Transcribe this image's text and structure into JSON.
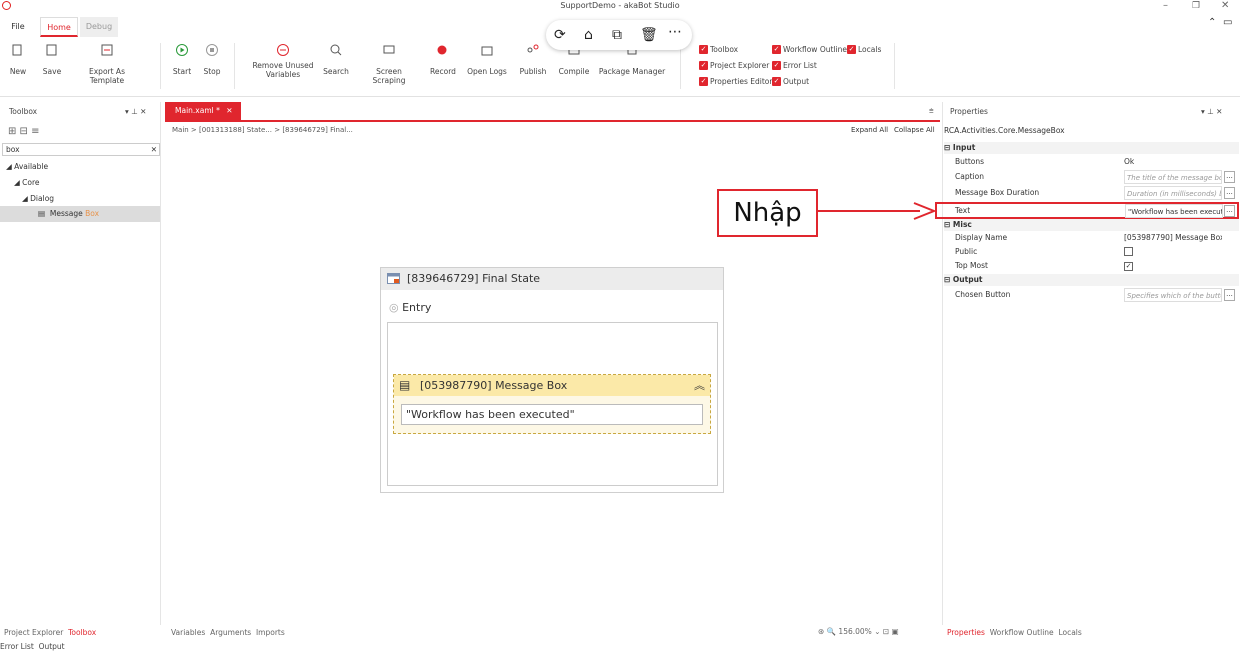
{
  "window": {
    "title": "SupportDemo - akaBot Studio"
  },
  "menu_tabs": [
    {
      "label": "File"
    },
    {
      "label": "Home"
    },
    {
      "label": "Debug"
    }
  ],
  "ribbon": {
    "new": "New",
    "save": "Save",
    "export": "Export As Template",
    "start": "Start",
    "stop": "Stop",
    "remove_unused_1": "Remove Unused",
    "remove_unused_2": "Variables",
    "search": "Search",
    "screen_scraping": "Screen Scraping",
    "record": "Record",
    "open_logs": "Open Logs",
    "publish": "Publish",
    "compile": "Compile",
    "package_manager": "Package Manager"
  },
  "view_toggles": {
    "toolbox": "Toolbox",
    "project_explorer": "Project Explorer",
    "properties_editor": "Properties Editor",
    "workflow_outline": "Workflow Outline",
    "error_list": "Error List",
    "output": "Output",
    "locals": "Locals"
  },
  "toolbox": {
    "title": "Toolbox",
    "search_value": "box",
    "tree": {
      "available": "Available",
      "core": "Core",
      "dialog": "Dialog",
      "item_prefix": "Message ",
      "item_highlight": "Box"
    }
  },
  "document": {
    "tab": "Main.xaml *",
    "breadcrumb": "Main  >  [001313188] State...  >  [839646729] Final...",
    "expand_all": "Expand All",
    "collapse_all": "Collapse All",
    "state_title": "[839646729] Final State",
    "entry": "Entry",
    "activity_title": "[053987790] Message Box",
    "activity_text": "\"Workflow has been executed\""
  },
  "annotation": {
    "label": "Nhập",
    "color": "#e0262e"
  },
  "properties": {
    "title": "Properties",
    "type_name": "RCA.Activities.Core.MessageBox",
    "cat_input": "Input",
    "cat_misc": "Misc",
    "cat_output": "Output",
    "buttons_k": "Buttons",
    "buttons_v": "Ok",
    "caption_k": "Caption",
    "caption_v": "The title of the message box",
    "duration_k": "Message Box Duration",
    "duration_v": "Duration (in milliseconds) b",
    "text_k": "Text",
    "text_v": "\"Workflow has been execut",
    "display_k": "Display Name",
    "display_v": "[053987790] Message Box",
    "public_k": "Public",
    "public_checked": false,
    "topmost_k": "Top Most",
    "topmost_checked": true,
    "chosen_k": "Chosen Button",
    "chosen_v": "Specifies which of the butto"
  },
  "bottom": {
    "left_tabs": [
      "Project Explorer",
      "Toolbox"
    ],
    "left_tabs2": [
      "Error List",
      "Output"
    ],
    "center_tabs": [
      "Variables",
      "Arguments",
      "Imports"
    ],
    "zoom": "156.00%",
    "right_tabs": [
      "Properties",
      "Workflow Outline",
      "Locals"
    ]
  },
  "colors": {
    "accent": "#e0262e"
  }
}
